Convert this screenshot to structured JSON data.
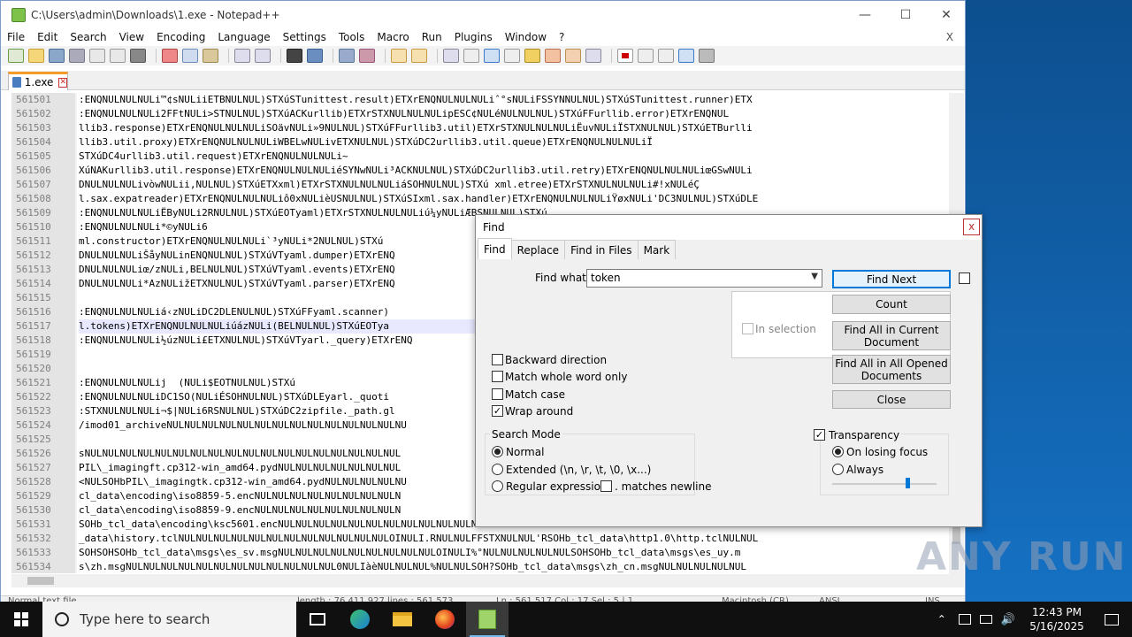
{
  "window": {
    "title": "C:\\Users\\admin\\Downloads\\1.exe - Notepad++",
    "close_menu_x": "X"
  },
  "menu": [
    "File",
    "Edit",
    "Search",
    "View",
    "Encoding",
    "Language",
    "Settings",
    "Tools",
    "Macro",
    "Run",
    "Plugins",
    "Window",
    "?"
  ],
  "tab": {
    "label": "1.exe"
  },
  "editor": {
    "lines": [
      {
        "n": "561501",
        "t": ":ENQNULNULNULi™¢sNULiiETBNULNUL)STXúSTunittest.result)ETXrENQNULNULNULiˆ°sNULiFSSYNNULNUL)STXúSTunittest.runner)ETX"
      },
      {
        "n": "561502",
        "t": ":ENQNULNULNULi2FFtNULi>STNULNUL)STXúACKurllib)ETXrSTXNULNULNULipESC¢NULéNULNULNUL)STXúFFurllib.error)ETXrENQNUL"
      },
      {
        "n": "561503",
        "t": "llib3.response)ETXrENQNULNULNULiSOävNULi»9NULNUL)STXúFFurllib3.util)ETXrSTXNULNULNULiËuvNULiÏSTXNULNUL)STXúETBurlli"
      },
      {
        "n": "561504",
        "t": "llib3.util.proxy)ETXrENQNULNULNULiWBELwNULivETXNULNUL)STXúDC2urllib3.util.queue)ETXrENQNULNULNULiÏ"
      },
      {
        "n": "561505",
        "t": "STXúDC4urllib3.util.request)ETXrENQNULNULNULi~"
      },
      {
        "n": "561506",
        "t": "XúNAKurllib3.util.response)ETXrENQNULNULNULiéSYNwNULi³ACKNULNUL)STXúDC2urllib3.util.retry)ETXrENQNULNULNULiœGSwNULi"
      },
      {
        "n": "561507",
        "t": "DNULNULNULivòwNULii,NULNUL)STXúETXxml)ETXrSTXNULNULNULiáSOHNULNUL)STXú xml.etree)ETXrSTXNULNULNULi#!xNULéÇ"
      },
      {
        "n": "561508",
        "t": "l.sax.expatreader)ETXrENQNULNULNULiô0xNULièUSNULNUL)STXúSIxml.sax.handler)ETXrENQNULNULNULiŸøxNULi'DC3NULNUL)STXúDLE"
      },
      {
        "n": "561509",
        "t": ":ENQNULNULNULiËByNULi2RNULNUL)STXúEOTyaml)ETXrSTXNULNULNULiú¼yNULiÆBSNULNUL)STXú"
      },
      {
        "n": "561510",
        "t": ":ENQNULNULNULi*©yNULi6"
      },
      {
        "n": "561511",
        "t": "ml.constructor)ETXrENQNULNULNULi`³yNULi*2NULNUL)STXú"
      },
      {
        "n": "561512",
        "t": "DNULNULNULiŠåyNULinENQNULNUL)STXúVTyaml.dumper)ETXrENQ"
      },
      {
        "n": "561513",
        "t": "DNULNULNULiœ/zNULi,BELNULNUL)STXúVTyaml.events)ETXrENQ"
      },
      {
        "n": "561514",
        "t": "DNULNULNULi*AzNULižETXNULNUL)STXúVTyaml.parser)ETXrENQ"
      },
      {
        "n": "561515",
        "t": ""
      },
      {
        "n": "561516",
        "t": ":ENQNULNULNULiá‹zNULiDC2DLENULNUL)STXúFFyaml.scanner)"
      },
      {
        "n": "561517",
        "t": "l.tokens)ETXrENQNULNULNULiúázNULi(BELNULNUL)STXúEOTya"
      },
      {
        "n": "561518",
        "t": ":ENQNULNULNULi½úzNULi£ETXNULNUL)STXúVTyarl._query)ETXrENQ"
      },
      {
        "n": "561519",
        "t": ""
      },
      {
        "n": "561520",
        "t": ""
      },
      {
        "n": "561521",
        "t": ":ENQNULNULNULij  (NULi$EOTNULNUL)STXú"
      },
      {
        "n": "561522",
        "t": ":ENQNULNULNULiDC1SO(NULiÉSOHNULNUL)STXúDLEyarl._quoti"
      },
      {
        "n": "561523",
        "t": ":STXNULNULNULi¬$|NULi6RSNULNUL)STXúDC2zipfile._path.gl"
      },
      {
        "n": "561524",
        "t": "/imod01_archiveNULNULNULNULNULNULNULNULNULNULNULNULNULNU"
      },
      {
        "n": "561525",
        "t": ""
      },
      {
        "n": "561526",
        "t": "sNULNULNULNULNULNULNULNULNULNULNULNULNULNULNULNULNULNUL"
      },
      {
        "n": "561527",
        "t": "PIL\\_imagingft.cp312-win_amd64.pydNULNULNULNULNULNULNUL"
      },
      {
        "n": "561528",
        "t": "<NULSOHbPIL\\_imagingtk.cp312-win_amd64.pydNULNULNULNULNU"
      },
      {
        "n": "561529",
        "t": "cl_data\\encoding\\iso8859-5.encNULNULNULNULNULNULNULNULN"
      },
      {
        "n": "561530",
        "t": "cl_data\\encoding\\iso8859-9.encNULNULNULNULNULNULNULNULN"
      },
      {
        "n": "561531",
        "t": "SOHb_tcl_data\\encoding\\ksc5601.encNULNULNULNULNULNULNULNULNULNULNULNULNULNULNULNULNULNULNULNULNULNULNULNULNUL"
      },
      {
        "n": "561532",
        "t": "_data\\history.tclNULNULNULNULNULNULNULNULNULNULNULNULOINULI.RNULNULFFSTXNULNUL'RSOHb_tcl_data\\http1.0\\http.tclNULNUL"
      },
      {
        "n": "561533",
        "t": "SOHSOHSOHb_tcl_data\\msgs\\es_sv.msgNULNULNULNULNULNULNULNULNULOINULI%°NULNULNULNULNULSOHSOHb_tcl_data\\msgs\\es_uy.m"
      },
      {
        "n": "561534",
        "t": "s\\zh.msgNULNULNULNULNULNULNULNULNULNULNULNUL0NULIàèNULNULNUL%NULNULSOH?SOHb_tcl_data\\msgs\\zh_cn.msgNULNULNULNULNUL"
      }
    ]
  },
  "statusbar": {
    "left": "Normal text file",
    "length": "length : 76,411,927    lines : 561,573",
    "pos": "Ln : 561,517    Col : 17    Sel : 5 | 1",
    "eol": "Macintosh (CR)",
    "enc": "ANSI",
    "ins": "INS"
  },
  "find": {
    "title": "Find",
    "close": "x",
    "tabs": [
      "Find",
      "Replace",
      "Find in Files",
      "Mark"
    ],
    "find_what_label": "Find what :",
    "find_what_value": "token",
    "in_selection": "In selection",
    "buttons": {
      "find_next": "Find Next",
      "count": "Count",
      "find_all_current": "Find All in Current Document",
      "find_all_opened": "Find All in All Opened Documents",
      "close": "Close"
    },
    "options": {
      "backward": "Backward direction",
      "whole_word": "Match whole word only",
      "match_case": "Match case",
      "wrap_around": "Wrap around"
    },
    "search_mode": {
      "label": "Search Mode",
      "normal": "Normal",
      "extended": "Extended (\\n, \\r, \\t, \\0, \\x...)",
      "regex": "Regular expression",
      "matches_newline": ". matches newline"
    },
    "transparency": {
      "label": "Transparency",
      "on_losing_focus": "On losing focus",
      "always": "Always",
      "level": 0.72
    }
  },
  "taskbar": {
    "search_placeholder": "Type here to search",
    "time": "12:43 PM",
    "date": "5/16/2025"
  },
  "watermark": "ANY RUN"
}
